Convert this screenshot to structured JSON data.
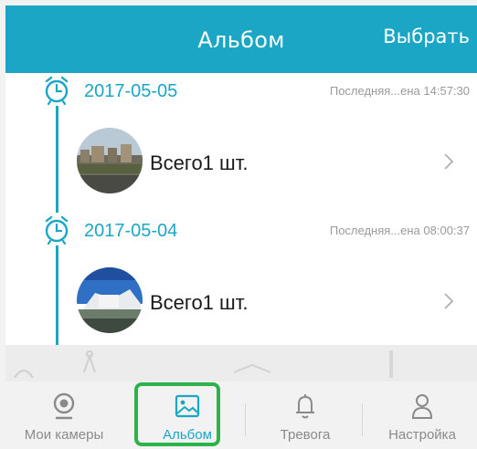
{
  "header": {
    "title": "Альбом",
    "action_label": "Выбрать"
  },
  "groups": [
    {
      "date": "2017-05-05",
      "last_text": "Последняя...ена 14:57:30",
      "count_label": "Всего1 шт."
    },
    {
      "date": "2017-05-04",
      "last_text": "Последняя...ена 08:00:37",
      "count_label": "Всего1 шт."
    }
  ],
  "tabs": [
    {
      "label": "Мои камеры",
      "icon": "camera-icon",
      "active": false
    },
    {
      "label": "Альбом",
      "icon": "image-icon",
      "active": true
    },
    {
      "label": "Тревога",
      "icon": "bell-icon",
      "active": false
    },
    {
      "label": "Настройка",
      "icon": "user-icon",
      "active": false
    }
  ],
  "colors": {
    "accent": "#1ba6c6",
    "highlight": "#2cb34a",
    "inactive": "#8a8a8a"
  }
}
